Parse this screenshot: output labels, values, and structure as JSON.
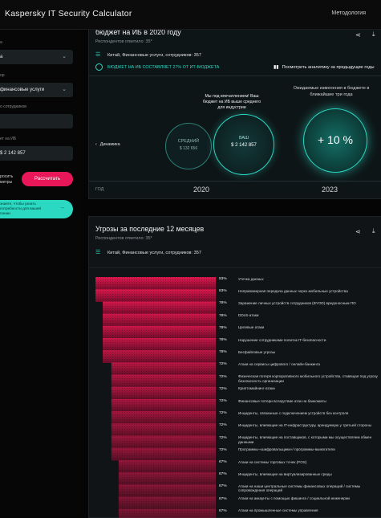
{
  "header": {
    "title": "Kaspersky IT Security Calculator",
    "methodology_link": "Методология"
  },
  "sidebar": {
    "fields": [
      {
        "label": "а",
        "value": "а",
        "has_dropdown": true
      },
      {
        "label": "ор",
        "value": "финансовые услуги",
        "has_dropdown": true
      },
      {
        "label": "о сотрудников",
        "value": "",
        "has_dropdown": false
      },
      {
        "label": "ет на ИБ",
        "value": "$ 2 142 857",
        "has_dropdown": false
      }
    ],
    "reset_label": "росить\nметры",
    "calculate_button": "Рассчитать",
    "promo_text": "знаете, чтобы узнать\nпотребности для вашей\nпании",
    "promo_arrow": "→"
  },
  "budget_card": {
    "title": "бюджет на ИБ в 2020 году",
    "respondents": "Респондентов ответило: 35*",
    "filter": "Китай, Финансовые услуги, сотрудников: 357",
    "budget_note": "БЮДЖЕТ НА ИБ СОСТАВЛЯЕТ 27% ОТ ИТ-БЮДЖЕТА",
    "prev_years_link": "Посмотреть аналитику за предыдущие годы",
    "dynamics_label": "Динамика",
    "message": "Мы под впечатлением! Ваш бюджет на ИБ выше среднего для индустрии",
    "average_label": "СРЕДНИЙ",
    "average_value": "$ 132 656",
    "our_label": "ВАШ",
    "our_value": "$ 2 142 857",
    "expectation_text": "Ожидаемые изменения в бюджете в ближайшие три года",
    "forecast_value": "+ 10 %",
    "year_axis_label": "ГОД",
    "year_current": "2020",
    "year_forecast": "2023"
  },
  "threats_card": {
    "title": "Угрозы за последние 12 месяцев",
    "respondents": "Респондентов ответило: 35*",
    "filter": "Китай, Финансовые услуги, сотрудников: 357",
    "accent_color": "#e0184f",
    "items": [
      {
        "percent": "83%",
        "value": 83,
        "label": "Утечка данных"
      },
      {
        "percent": "83%",
        "value": 83,
        "label": "Неправомерная передача данных через мобильные устройства"
      },
      {
        "percent": "78%",
        "value": 78,
        "label": "Заражение личных устройств сотрудников (BYOD) вредоносным ПО"
      },
      {
        "percent": "78%",
        "value": 78,
        "label": "DDoS-атаки"
      },
      {
        "percent": "78%",
        "value": 78,
        "label": "Целевые атаки"
      },
      {
        "percent": "78%",
        "value": 78,
        "label": "Нарушение сотрудниками политик IT-безопасности"
      },
      {
        "percent": "78%",
        "value": 78,
        "label": "Бесфайловые угрозы"
      },
      {
        "percent": "72%",
        "value": 72,
        "label": "Атаки на сервисы цифрового / онлайн-банкинга"
      },
      {
        "percent": "72%",
        "value": 72,
        "label": "Физическая потеря корпоративного мобильного устройства, ставящая под угрозу безопасность организации"
      },
      {
        "percent": "72%",
        "value": 72,
        "label": "Криптомайнинг-атаки"
      },
      {
        "percent": "72%",
        "value": 72,
        "label": "Финансовые потери вследствие атак на банкоматы"
      },
      {
        "percent": "72%",
        "value": 72,
        "label": "Инциденты, связанные с подключением устройств без контроля"
      },
      {
        "percent": "72%",
        "value": 72,
        "label": "Инциденты, влияющие на IT-инфраструктуру, арендуемую у третьей стороны"
      },
      {
        "percent": "72%",
        "value": 72,
        "label": "Инциденты, влияющие на поставщиков, с которыми мы осуществляем обмен данными"
      },
      {
        "percent": "72%",
        "value": 72,
        "label": "Программы-«шифровальщики»/ программы-вымогатели"
      },
      {
        "percent": "67%",
        "value": 67,
        "label": "Атаки на системы торговых точек (POS)"
      },
      {
        "percent": "67%",
        "value": 67,
        "label": "Инциденты, влияющие на виртуализированные среды"
      },
      {
        "percent": "67%",
        "value": 67,
        "label": "Атаки на наши центральные системы финансовых операций / системы сопровождения операций"
      },
      {
        "percent": "67%",
        "value": 67,
        "label": "Атаки на аккаунты с помощью фишинга / социальной инженерии"
      },
      {
        "percent": "67%",
        "value": 67,
        "label": "Атаки на промышленные системы управления"
      }
    ]
  }
}
